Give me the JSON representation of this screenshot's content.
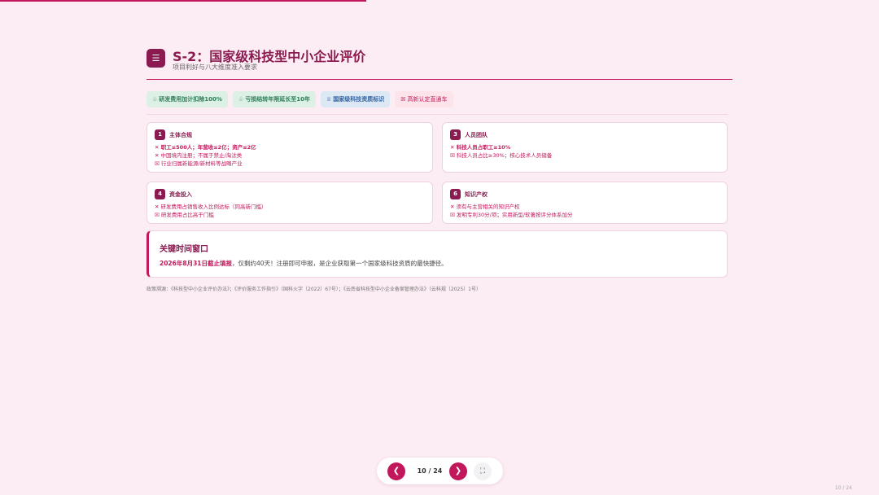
{
  "progress": {
    "fraction": 0.4167
  },
  "header": {
    "icon": "menu-icon",
    "title": "S-2：国家级科技型中小企业评价",
    "subtitle": "项目利好与八大维度准入要求"
  },
  "tags": [
    {
      "icon": "leaf-icon",
      "label": "研发费用加计扣除100%"
    },
    {
      "icon": "leaf-icon",
      "label": "亏损结转年限延长至10年"
    },
    {
      "icon": "trophy-icon",
      "label": "国家级科技资质标识"
    },
    {
      "icon": "box-icon",
      "label": "高新认定直通车"
    }
  ],
  "cards": [
    {
      "number": "1",
      "title": "主体合规",
      "lines": [
        "✕ 职工≤500人；年营收≤2亿；资产≤2亿",
        "✕ 中国境内注册；不属于禁止/淘汰类",
        "☒ 行业归属新能源/新材料等战略产业"
      ]
    },
    {
      "number": "3",
      "title": "人员团队",
      "lines": [
        "✕ 科技人员占职工≥10%",
        "☒ 科技人员占比≥30%；核心技术人员储备"
      ]
    },
    {
      "number": "4",
      "title": "资金投入",
      "lines": [
        "✕ 研发费用占销售收入比例达标（同高新门槛）",
        "☒ 研发费用占比高于门槛"
      ]
    },
    {
      "number": "6",
      "title": "知识产权",
      "lines": [
        "✕ 须有与主营相关的知识产权",
        "☒ 发明专利30分/项；实用新型/软著按评分体系加分"
      ]
    }
  ],
  "window": {
    "title": "关键时间窗口",
    "highlight": "2026年8月31日截止填报",
    "text": "，仅剩约40天！注册即可申报，是企业获取第一个国家级科技资质的最快捷径。"
  },
  "source": "政策溯源：《科技型中小企业评价办法》；《评价服务工作指引》（国科火字〔2022〕67号）；《云南省科技型中小企业备案管理办法》（云科规〔2025〕1号）",
  "pager": {
    "prev_icon": "chevron-left-icon",
    "prev_label": "❮",
    "counter": "10 / 24",
    "next_icon": "chevron-right-icon",
    "next_label": "❯",
    "fullscreen_icon": "fullscreen-icon",
    "fullscreen_label": "⛶"
  },
  "corner_page": "10 / 24",
  "colors": {
    "accent": "#c2185b",
    "brand": "#8a1a4f",
    "background": "#fcecf3"
  }
}
